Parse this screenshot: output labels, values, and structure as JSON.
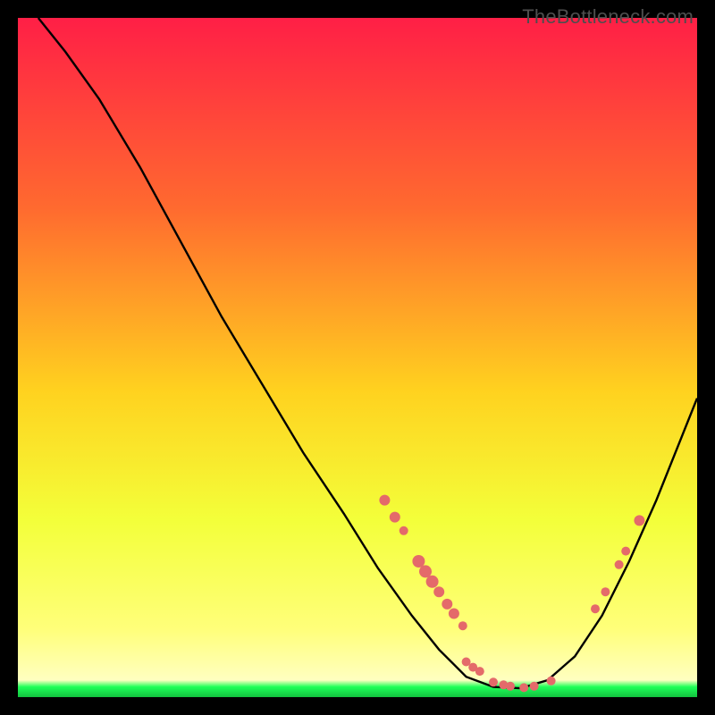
{
  "watermark": "TheBottleneck.com",
  "colors": {
    "gradient_top": "#ff1f46",
    "gradient_mid1": "#ff6a2f",
    "gradient_mid2": "#ffd21f",
    "gradient_mid3": "#f3ff3a",
    "gradient_bottom_yellow": "#ffff7a",
    "gradient_green": "#1eff58",
    "curve": "#000000",
    "marker": "#e46a6a"
  },
  "chart_data": {
    "type": "line",
    "title": "",
    "xlabel": "",
    "ylabel": "",
    "xlim": [
      0,
      100
    ],
    "ylim": [
      0,
      100
    ],
    "curve": [
      {
        "x": 3,
        "y": 100
      },
      {
        "x": 7,
        "y": 95
      },
      {
        "x": 12,
        "y": 88
      },
      {
        "x": 18,
        "y": 78
      },
      {
        "x": 24,
        "y": 67
      },
      {
        "x": 30,
        "y": 56
      },
      {
        "x": 36,
        "y": 46
      },
      {
        "x": 42,
        "y": 36
      },
      {
        "x": 48,
        "y": 27
      },
      {
        "x": 53,
        "y": 19
      },
      {
        "x": 58,
        "y": 12
      },
      {
        "x": 62,
        "y": 7
      },
      {
        "x": 66,
        "y": 3
      },
      {
        "x": 70,
        "y": 1.5
      },
      {
        "x": 74,
        "y": 1.3
      },
      {
        "x": 78,
        "y": 2.5
      },
      {
        "x": 82,
        "y": 6
      },
      {
        "x": 86,
        "y": 12
      },
      {
        "x": 90,
        "y": 20
      },
      {
        "x": 94,
        "y": 29
      },
      {
        "x": 98,
        "y": 39
      },
      {
        "x": 100,
        "y": 44
      }
    ],
    "markers": [
      {
        "x": 54,
        "y": 29,
        "r": 6
      },
      {
        "x": 55.5,
        "y": 26.5,
        "r": 6
      },
      {
        "x": 56.8,
        "y": 24.5,
        "r": 5
      },
      {
        "x": 59,
        "y": 20,
        "r": 7
      },
      {
        "x": 60,
        "y": 18.5,
        "r": 7
      },
      {
        "x": 61,
        "y": 17,
        "r": 7
      },
      {
        "x": 62,
        "y": 15.5,
        "r": 6
      },
      {
        "x": 63.2,
        "y": 13.7,
        "r": 6
      },
      {
        "x": 64.2,
        "y": 12.3,
        "r": 6
      },
      {
        "x": 65.5,
        "y": 10.5,
        "r": 5
      },
      {
        "x": 66,
        "y": 5.2,
        "r": 5
      },
      {
        "x": 67,
        "y": 4.4,
        "r": 5
      },
      {
        "x": 68,
        "y": 3.8,
        "r": 5
      },
      {
        "x": 70,
        "y": 2.2,
        "r": 5
      },
      {
        "x": 71.5,
        "y": 1.8,
        "r": 5
      },
      {
        "x": 72.5,
        "y": 1.6,
        "r": 5
      },
      {
        "x": 74.5,
        "y": 1.4,
        "r": 5
      },
      {
        "x": 76,
        "y": 1.6,
        "r": 5
      },
      {
        "x": 78.5,
        "y": 2.4,
        "r": 5
      },
      {
        "x": 85,
        "y": 13,
        "r": 5
      },
      {
        "x": 86.5,
        "y": 15.5,
        "r": 5
      },
      {
        "x": 88.5,
        "y": 19.5,
        "r": 5
      },
      {
        "x": 89.5,
        "y": 21.5,
        "r": 5
      },
      {
        "x": 91.5,
        "y": 26,
        "r": 6
      }
    ]
  }
}
